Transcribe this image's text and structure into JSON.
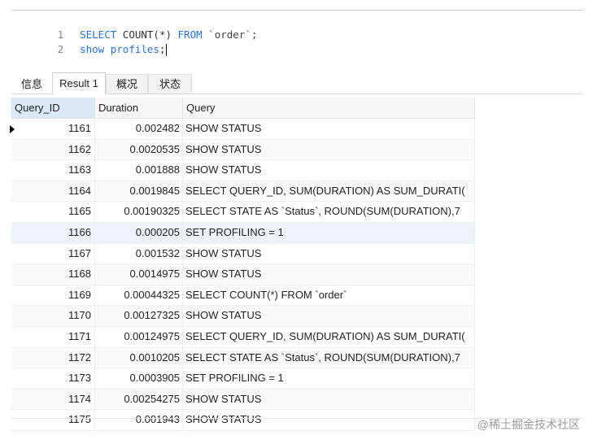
{
  "editor": {
    "lines": [
      {
        "num": "1",
        "kw1": "SELECT",
        "t1": " COUNT(*) ",
        "kw2": "FROM",
        "t2": " `order`;"
      },
      {
        "num": "2",
        "kw1": "show profiles",
        "t1": ";",
        "kw2": "",
        "t2": ""
      }
    ]
  },
  "tabs": [
    "信息",
    "Result 1",
    "概况",
    "状态"
  ],
  "grid": {
    "columns": [
      "Query_ID",
      "Duration",
      "Query"
    ],
    "rows": [
      {
        "id": "1161",
        "duration": "0.002482",
        "query": "SHOW STATUS"
      },
      {
        "id": "1162",
        "duration": "0.0020535",
        "query": "SHOW STATUS"
      },
      {
        "id": "1163",
        "duration": "0.001888",
        "query": "SHOW STATUS"
      },
      {
        "id": "1164",
        "duration": "0.0019845",
        "query": "SELECT QUERY_ID, SUM(DURATION) AS SUM_DURATI("
      },
      {
        "id": "1165",
        "duration": "0.00190325",
        "query": "SELECT STATE AS `Status`, ROUND(SUM(DURATION),7"
      },
      {
        "id": "1166",
        "duration": "0.000205",
        "query": "SET PROFILING = 1"
      },
      {
        "id": "1167",
        "duration": "0.001532",
        "query": "SHOW STATUS"
      },
      {
        "id": "1168",
        "duration": "0.0014975",
        "query": "SHOW STATUS"
      },
      {
        "id": "1169",
        "duration": "0.00044325",
        "query": "SELECT COUNT(*) FROM `order`"
      },
      {
        "id": "1170",
        "duration": "0.00127325",
        "query": "SHOW STATUS"
      },
      {
        "id": "1171",
        "duration": "0.00124975",
        "query": "SELECT QUERY_ID, SUM(DURATION) AS SUM_DURATI("
      },
      {
        "id": "1172",
        "duration": "0.0010205",
        "query": "SELECT STATE AS `Status`, ROUND(SUM(DURATION),7"
      },
      {
        "id": "1173",
        "duration": "0.0003905",
        "query": "SET PROFILING = 1"
      },
      {
        "id": "1174",
        "duration": "0.00254275",
        "query": "SHOW STATUS"
      },
      {
        "id": "1175",
        "duration": "0.001943",
        "query": "SHOW STATUS"
      }
    ]
  },
  "watermark": "@稀土掘金技术社区"
}
